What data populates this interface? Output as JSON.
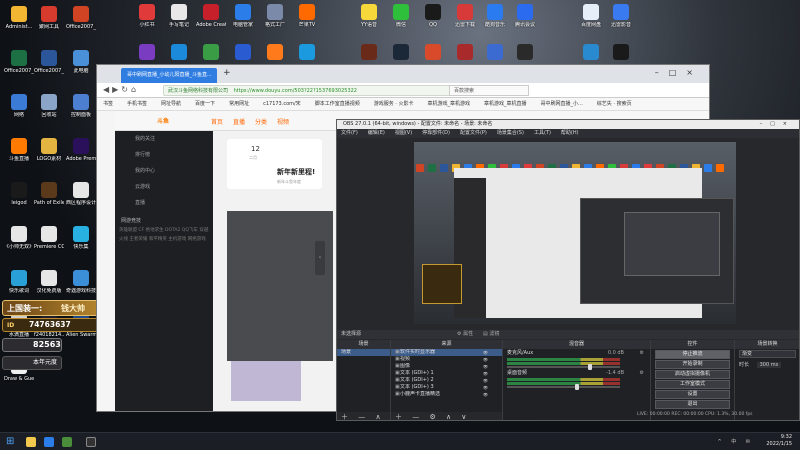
{
  "desktop": {
    "icons_left": [
      {
        "label": "Administ...",
        "icon": "user-icon",
        "color": "#f2b632"
      },
      {
        "label": "聚网工具",
        "icon": "tool-icon",
        "color": "#d63b2e"
      },
      {
        "label": "Office2007_已打开PPT",
        "icon": "ppt-icon",
        "color": "#d04423"
      },
      {
        "label": "Office2007_表格",
        "icon": "excel-icon",
        "color": "#1d7044"
      },
      {
        "label": "Office2007_文字",
        "icon": "word-icon",
        "color": "#2b579a"
      },
      {
        "label": "此电脑",
        "icon": "computer-icon",
        "color": "#4a90d9"
      },
      {
        "label": "网络",
        "icon": "network-icon",
        "color": "#3b7bd6"
      },
      {
        "label": "回收站",
        "icon": "recycle-icon",
        "color": "#8aa5c8"
      },
      {
        "label": "控制面板",
        "icon": "control-panel-icon",
        "color": "#4c7fd0"
      },
      {
        "label": "斗鱼直播",
        "icon": "douyu-icon",
        "color": "#ff7a00"
      },
      {
        "label": "LOGO素材",
        "icon": "folder-icon",
        "color": "#e4b440"
      },
      {
        "label": "Adobe Premie...",
        "icon": "premiere-icon",
        "color": "#2a0f5a"
      },
      {
        "label": "leigod",
        "icon": "leigod-icon",
        "color": "#1a1a1a"
      },
      {
        "label": "Path of Exile",
        "icon": "poe-icon",
        "color": "#5a3a1a"
      },
      {
        "label": "西区程序设计",
        "icon": "file-icon",
        "color": "#e6e6e6"
      },
      {
        "label": "《小帅无双》奇趣直播",
        "icon": "search-doc-icon",
        "color": "#e6e6e6"
      },
      {
        "label": "Premiere CC2018",
        "icon": "file-icon",
        "color": "#e6e6e6"
      },
      {
        "label": "快乐集",
        "icon": "qq-music-icon",
        "color": "#27b0e0"
      },
      {
        "label": "快乐歌词",
        "icon": "folder-icon",
        "color": "#2aa0d8"
      },
      {
        "label": "汉化免费版",
        "icon": "file-icon",
        "color": "#e6e6e6"
      },
      {
        "label": "奇遇游戏科技直播",
        "icon": "image-icon",
        "color": "#3b8fd8"
      },
      {
        "label": "水滴直播",
        "icon": "file-icon",
        "color": "#cfcfcf"
      },
      {
        "label": "f24018214...",
        "icon": "video-icon",
        "color": "#1e1e2e"
      },
      {
        "label": "Alien Swarm",
        "icon": "alien-swarm-icon",
        "color": "#1f4b8a"
      },
      {
        "label": "Draw & Guess",
        "icon": "draw-guess-icon",
        "color": "#f0f0f0"
      }
    ],
    "icons_top": [
      {
        "label": "小红书",
        "icon": "app-icon",
        "color": "#e13a3a"
      },
      {
        "label": "手写笔记",
        "icon": "note-icon",
        "color": "#e8e8e8"
      },
      {
        "label": "Adobe Creati...",
        "icon": "adobe-icon",
        "color": "#c8202a"
      },
      {
        "label": "电脑管家",
        "icon": "shield-icon",
        "color": "#2b7de9"
      },
      {
        "label": "格式工厂",
        "icon": "format-factory-icon",
        "color": "#7a8aa8"
      },
      {
        "label": "芒果TV",
        "icon": "mango-tv-icon",
        "color": "#ff6a00"
      },
      {
        "label": "YY语音",
        "icon": "yy-icon",
        "color": "#f7d83a"
      },
      {
        "label": "微信",
        "icon": "wechat-icon",
        "color": "#2ec03a"
      },
      {
        "label": "QQ",
        "icon": "qq-icon",
        "color": "#1a1a1a"
      },
      {
        "label": "迅雷下载",
        "icon": "xunlei-icon",
        "color": "#d83a3a"
      },
      {
        "label": "酷狗音乐",
        "icon": "kugou-icon",
        "color": "#2a7bf0"
      },
      {
        "label": "腾讯会议",
        "icon": "meeting-icon",
        "color": "#2a6bf0"
      },
      {
        "label": "百度网盘",
        "icon": "cloud-icon",
        "color": "#e6eef9"
      },
      {
        "label": "迅雷影音",
        "icon": "feishu-icon",
        "color": "#3a7af0"
      }
    ],
    "icons_top_row2": [
      {
        "icon": "game-icon",
        "color": "#7a3cc0"
      },
      {
        "icon": "edge-icon",
        "color": "#1c8adb"
      },
      {
        "icon": "chrome-icon",
        "color": "#3a9d45"
      },
      {
        "icon": "app-icon",
        "color": "#2a5bd0"
      },
      {
        "icon": "firefox-icon",
        "color": "#ff7a1a"
      },
      {
        "icon": "edge-icon",
        "color": "#1c9ae0"
      },
      {
        "icon": "hero-icon",
        "color": "#6a2a1a"
      },
      {
        "icon": "steam-icon",
        "color": "#1b2838"
      },
      {
        "icon": "game-icon",
        "color": "#d84a2a"
      },
      {
        "icon": "game-icon",
        "color": "#a82a2a"
      },
      {
        "icon": "game-icon",
        "color": "#3b6bd0"
      },
      {
        "icon": "obs-icon",
        "color": "#2a2a2a"
      },
      {
        "icon": "app-icon",
        "color": "#2a8ad0"
      },
      {
        "icon": "app-icon",
        "color": "#1a1a1a"
      }
    ]
  },
  "browser": {
    "tab_title": "哥中刷网直播_小幼儿阳直播_斗鱼直...",
    "cert": "武汉斗鱼网络科技有限公司",
    "url": "https://www.douyu.com/503?22?1537693025322",
    "search_placeholder": "百款搜索",
    "bookmarks": [
      "书签",
      "手机书签",
      "网址导航",
      "百度一下",
      "常用网址",
      "c17173.com/宋",
      "脚本工作室直播视频",
      "游戏服务 · 火影卡",
      "章机游戏_章机游戏",
      "章机游戏_章机直播",
      "哥中刷网直播_小...",
      "综艺失 · 搜索页"
    ]
  },
  "site": {
    "logo": "斗鱼",
    "menu": [
      "首页",
      "直播",
      "分类",
      "视频"
    ],
    "sidebar_items": [
      "我的关注",
      "排行榜",
      "我的中心",
      "云游戏",
      "直播"
    ],
    "categories": "网游竞技",
    "tags": "英雄联盟 CF 绝地求生 DOTA2 QQ飞车 穿越火线 王者荣耀 和平精英 主机游戏 网络游戏",
    "card_number": "12",
    "card_month": "二月",
    "banner_title": "新年新里程!",
    "banner_sub": "新年斗鱼年度"
  },
  "obs": {
    "title": "OBS 27.0.1 (64-bit, windows) - 配置文件: 未命名 - 场景: 未命名",
    "menu": [
      "文件(F)",
      "编辑(E)",
      "视图(V)",
      "停靠部件(D)",
      "配置文件(P)",
      "场景集合(S)",
      "工具(T)",
      "帮助(H)"
    ],
    "noscene": "未选择源",
    "props": "属性",
    "filters": "滤镜",
    "docks": {
      "scenes": {
        "title": "场景",
        "items": [
          "场景"
        ]
      },
      "sources": {
        "title": "来源",
        "items": [
          "软件实时显示器",
          "视频",
          "图像",
          "文本 (GDI+) 1",
          "文本 (GDI+) 2",
          "文本 (GDI+) 3",
          "小鹿声卡直播精选"
        ]
      },
      "mixer": {
        "title": "混音器",
        "channels": [
          {
            "name": "麦克风/Aux",
            "db": "0.0 dB",
            "level": 0.72
          },
          {
            "name": "桌面音频",
            "db": "-1.4 dB",
            "level": 0.6
          }
        ]
      },
      "controls": {
        "title": "控件",
        "buttons": [
          "停止推流",
          "开始录制",
          "启动虚拟摄像机",
          "工作室模式",
          "设置",
          "退出"
        ]
      },
      "transitions": {
        "title": "场景转换",
        "type": "渐变",
        "duration_label": "时长",
        "duration": "300 ms"
      }
    },
    "status": "LIVE: 00:00:00   REC: 00:00:00   CPU: 1.3%, 30.00 fps"
  },
  "overlay": {
    "name_a": "上国装一:",
    "name_b": "钱大帅",
    "id_label": "ID",
    "id_value": "74763637",
    "num": "82563",
    "small": "本年元度"
  },
  "taskbar": {
    "time": "9:32",
    "date": "2022/1/15",
    "tray": "^ 中 ✉"
  }
}
